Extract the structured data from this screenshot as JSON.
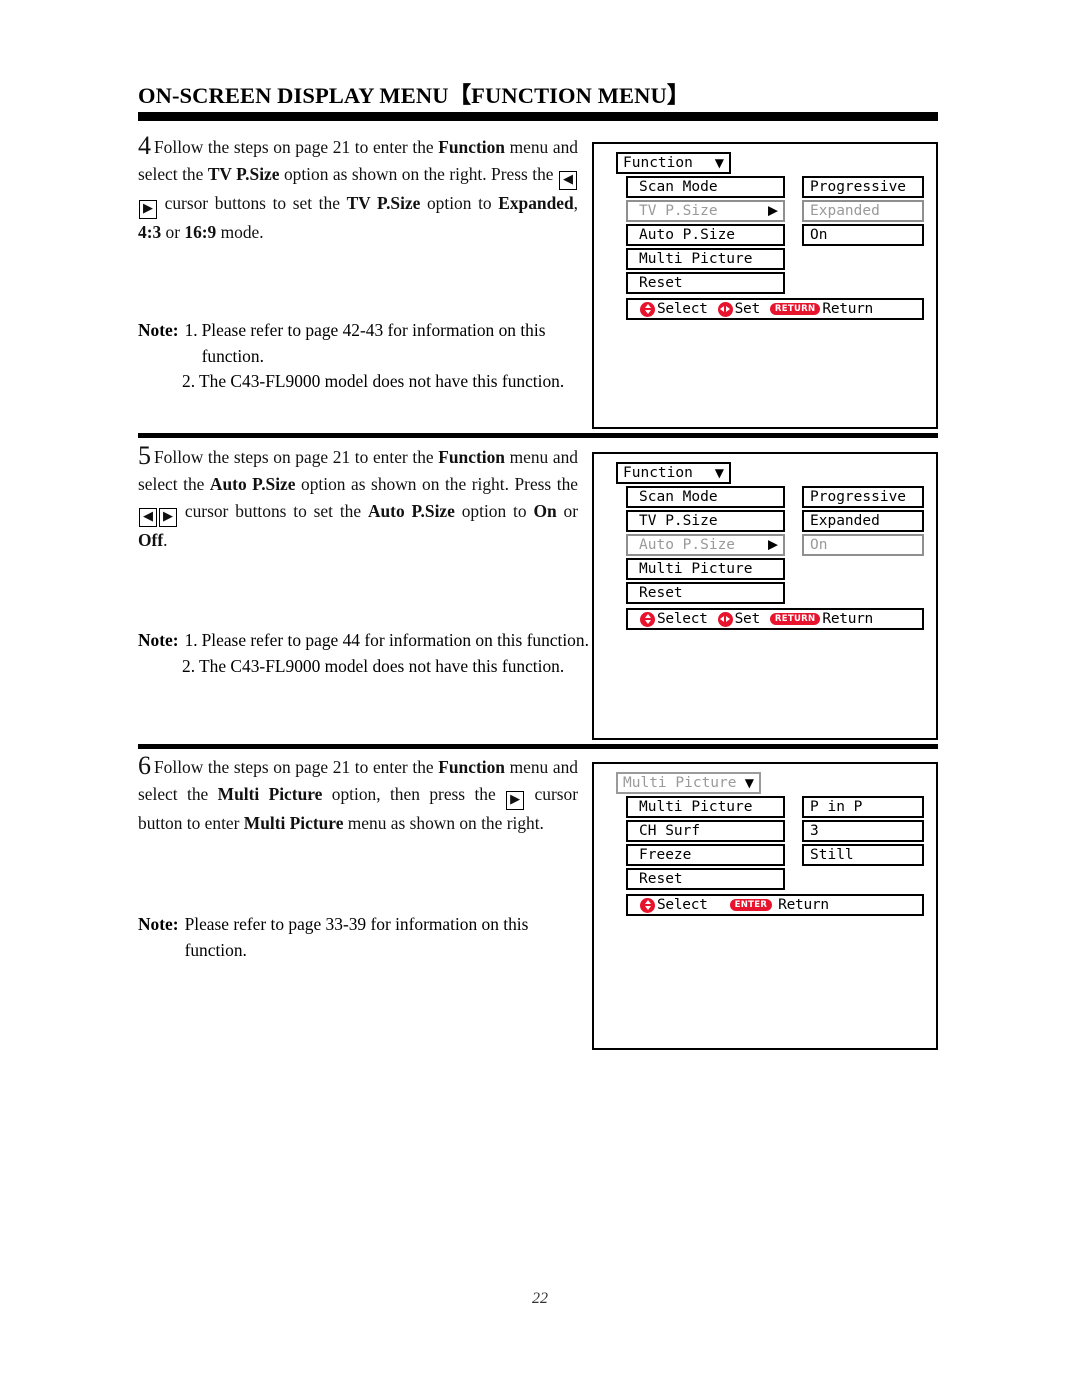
{
  "document": {
    "title": "ON-SCREEN DISPLAY MENU【FUNCTION MENU】",
    "page_number": "22"
  },
  "sections": [
    {
      "step_number": "4",
      "paragraph_parts": {
        "p1": "Follow the steps on page 21 to enter the ",
        "b1": "Function",
        "p2": " menu and select the ",
        "b2": "TV P.Size",
        "p3": " option as shown on the right. Press the ",
        "key_left": "◀",
        "key_right": "▶",
        "p4": " cursor buttons to set the ",
        "b3": "TV P.Size",
        "p5": " option to ",
        "b4": "Expanded",
        "p6": ", ",
        "b5": "4:3",
        "p7": " or ",
        "b6": "16:9",
        "p8": " mode."
      },
      "note": {
        "label": "Note:",
        "items": [
          {
            "num": "1.",
            "text": "Please refer to page 42-43 for information on this function."
          },
          {
            "num": "2.",
            "text": "The C43-FL9000 model does not have this function."
          }
        ]
      },
      "osd": {
        "title": "Function",
        "title_dim": false,
        "caret": "▼",
        "rows": [
          {
            "label": "Scan Mode",
            "value": "Progressive",
            "dim": false,
            "arrow": ""
          },
          {
            "label": "TV P.Size",
            "value": "Expanded",
            "dim": true,
            "arrow": "▶"
          },
          {
            "label": "Auto P.Size",
            "value": "On",
            "dim": false,
            "arrow": ""
          },
          {
            "label": "Multi Picture",
            "value": "",
            "dim": false,
            "arrow": ""
          },
          {
            "label": "Reset",
            "value": "",
            "dim": false,
            "arrow": ""
          }
        ],
        "hints": [
          {
            "icon": "select-updown-icon",
            "badge": "circle-updown",
            "text": "",
            "label": "Select"
          },
          {
            "icon": "set-leftright-icon",
            "badge": "circle-leftright",
            "text": "",
            "label": "Set"
          },
          {
            "icon": "return-key-icon",
            "badge": "pill",
            "text": "RETURN",
            "label": "Return"
          }
        ]
      }
    },
    {
      "step_number": "5",
      "paragraph_parts": {
        "p1": "Follow the steps on page 21 to enter the ",
        "b1": "Function",
        "p2": " menu and select the ",
        "b2": "Auto P.Size",
        "p3": " option as shown on the right. Press the ",
        "key_left": "◀",
        "key_right": "▶",
        "p4": " cursor buttons to set the ",
        "b3": "Auto P.Size",
        "p5": " option to ",
        "b4": "On",
        "p6": " or ",
        "b5": "Off",
        "p7": ".",
        "p8": ""
      },
      "note": {
        "label": "Note:",
        "items": [
          {
            "num": "1.",
            "text": "Please refer to page 44 for information on this function."
          },
          {
            "num": "2.",
            "text": "The C43-FL9000 model does not have this function."
          }
        ]
      },
      "osd": {
        "title": "Function",
        "title_dim": false,
        "caret": "▼",
        "rows": [
          {
            "label": "Scan Mode",
            "value": "Progressive",
            "dim": false,
            "arrow": ""
          },
          {
            "label": "TV P.Size",
            "value": "Expanded",
            "dim": false,
            "arrow": ""
          },
          {
            "label": "Auto P.Size",
            "value": "On",
            "dim": true,
            "arrow": "▶"
          },
          {
            "label": "Multi Picture",
            "value": "",
            "dim": false,
            "arrow": ""
          },
          {
            "label": "Reset",
            "value": "",
            "dim": false,
            "arrow": ""
          }
        ],
        "hints": [
          {
            "icon": "select-updown-icon",
            "badge": "circle-updown",
            "text": "",
            "label": "Select"
          },
          {
            "icon": "set-leftright-icon",
            "badge": "circle-leftright",
            "text": "",
            "label": "Set"
          },
          {
            "icon": "return-key-icon",
            "badge": "pill",
            "text": "RETURN",
            "label": "Return"
          }
        ]
      }
    },
    {
      "step_number": "6",
      "paragraph_parts": {
        "p1": "Follow the steps on page 21 to enter the ",
        "b1": "Function",
        "p2": " menu and select the ",
        "b2": "Multi Picture",
        "p3": " option, then press the ",
        "key_left": "",
        "key_right": "▶",
        "p4": " cursor button to enter ",
        "b3": "Multi Picture",
        "p5": " menu as shown on the right.",
        "b4": "",
        "p6": "",
        "b5": "",
        "p7": "",
        "p8": ""
      },
      "note": {
        "label": "Note:",
        "items": [
          {
            "num": "",
            "text": "Please refer to page 33-39 for information on this function."
          }
        ]
      },
      "osd": {
        "title": "Multi Picture",
        "title_dim": true,
        "caret": "▼",
        "rows": [
          {
            "label": "Multi Picture",
            "value": "P in P",
            "dim": false,
            "arrow": ""
          },
          {
            "label": "CH Surf",
            "value": "3",
            "dim": false,
            "arrow": ""
          },
          {
            "label": "Freeze",
            "value": "Still",
            "dim": false,
            "arrow": ""
          },
          {
            "label": "Reset",
            "value": "",
            "dim": false,
            "arrow": ""
          }
        ],
        "hints": [
          {
            "icon": "select-updown-icon",
            "badge": "circle-updown",
            "text": "",
            "label": "Select"
          },
          {
            "icon": "enter-key-icon",
            "badge": "pill",
            "text": "ENTER",
            "label": "Return"
          }
        ]
      }
    }
  ],
  "colors": {
    "badge_red": "#e8142d",
    "dim_gray": "#9a9a9a",
    "ink": "#000000"
  }
}
